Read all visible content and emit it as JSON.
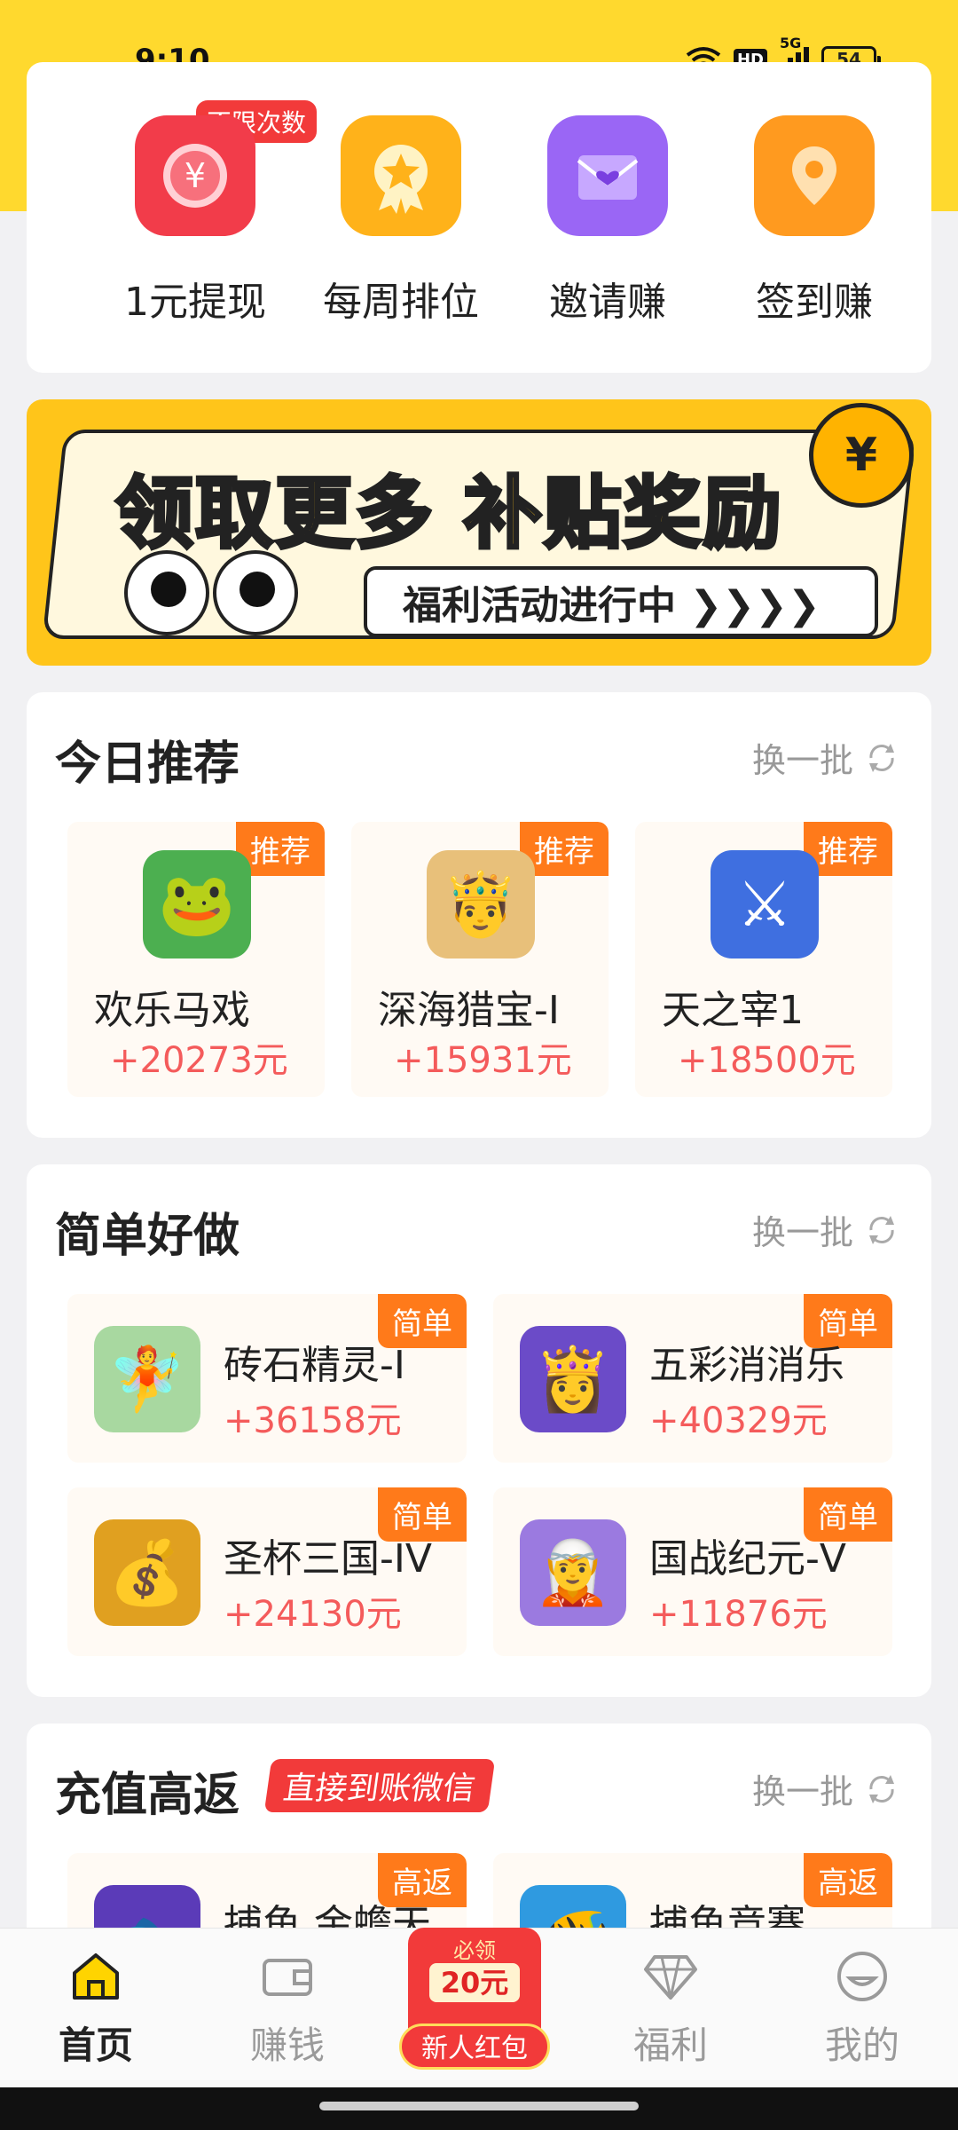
{
  "status": {
    "time": "9:10",
    "hd": "HD",
    "network": "5G",
    "battery": "54"
  },
  "quick_actions": {
    "badge": "不限次数",
    "items": [
      {
        "label": "1元提现",
        "icon": "yuan-icon",
        "color": "#f23c4a"
      },
      {
        "label": "每周排位",
        "icon": "medal-icon",
        "color": "#ffb21a"
      },
      {
        "label": "邀请赚",
        "icon": "heart-envelope-icon",
        "color": "#9a66f5"
      },
      {
        "label": "签到赚",
        "icon": "location-pin-icon",
        "color": "#ff9a1f"
      }
    ]
  },
  "banner": {
    "title": "领取更多 补贴奖励",
    "subtitle": "福利活动进行中 ❯❯❯❯",
    "coin": "¥"
  },
  "today": {
    "title": "今日推荐",
    "refresh": "换一批",
    "items": [
      {
        "badge": "推荐",
        "name": "欢乐马戏",
        "amount": "+20273元",
        "icon_color": "#4caf50",
        "icon_glyph": "🐸"
      },
      {
        "badge": "推荐",
        "name": "深海猎宝-I",
        "amount": "+15931元",
        "icon_color": "#e8c07a",
        "icon_glyph": "🤴"
      },
      {
        "badge": "推荐",
        "name": "天之宰1",
        "amount": "+18500元",
        "icon_color": "#3f6fe0",
        "icon_glyph": "⚔"
      }
    ]
  },
  "easy": {
    "title": "简单好做",
    "refresh": "换一批",
    "items": [
      {
        "badge": "简单",
        "name": "砖石精灵-I",
        "amount": "+36158元",
        "icon_color": "#a8d8a0",
        "icon_glyph": "🧚"
      },
      {
        "badge": "简单",
        "name": "五彩消消乐",
        "amount": "+40329元",
        "icon_color": "#6b4bc8",
        "icon_glyph": "👸"
      },
      {
        "badge": "简单",
        "name": "圣杯三国-IV",
        "amount": "+24130元",
        "icon_color": "#e0a020",
        "icon_glyph": "💰"
      },
      {
        "badge": "简单",
        "name": "国战纪元-V",
        "amount": "+11876元",
        "icon_color": "#9b7ae0",
        "icon_glyph": "🧝"
      }
    ]
  },
  "recharge": {
    "title": "充值高返",
    "tag": "直接到账微信",
    "refresh": "换一批",
    "items": [
      {
        "badge": "高返",
        "name": "捕鱼 金蟾天",
        "icon_color": "#5b3bb8",
        "icon_glyph": "🐟"
      },
      {
        "badge": "高返",
        "name": "捕鱼竞赛",
        "icon_color": "#2f9ae0",
        "icon_glyph": "🐠"
      }
    ]
  },
  "nav": {
    "items": [
      {
        "label": "首页",
        "icon": "home-icon",
        "active": true
      },
      {
        "label": "赚钱",
        "icon": "wallet-icon",
        "active": false
      },
      {
        "label": "福利",
        "icon": "diamond-icon",
        "active": false
      },
      {
        "label": "我的",
        "icon": "smile-face-icon",
        "active": false
      }
    ],
    "redpack": {
      "top": "必领",
      "amount": "20元",
      "label": "新人红包"
    }
  }
}
